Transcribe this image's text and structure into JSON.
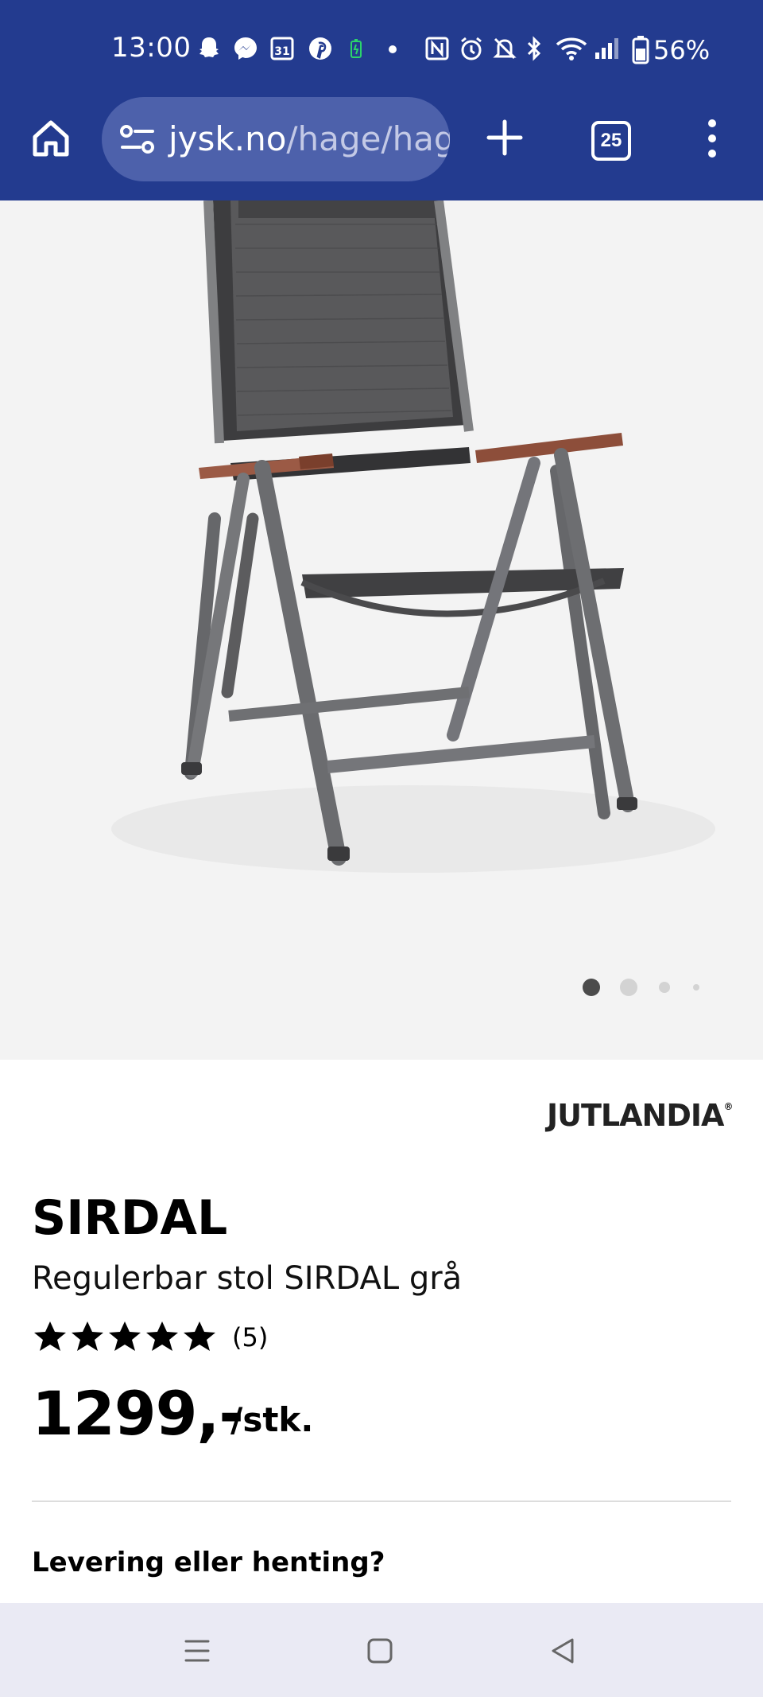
{
  "status_bar": {
    "time": "13:00",
    "battery_percent": "56%",
    "icons": [
      "snapchat-icon",
      "messenger-icon",
      "calendar-icon",
      "pinterest-icon",
      "battery-saver-icon",
      "dot-icon",
      "nfc-icon",
      "alarm-icon",
      "mute-icon",
      "bluetooth-icon",
      "wifi-icon",
      "signal-icon",
      "battery-icon"
    ],
    "calendar_day": "31"
  },
  "browser": {
    "url_domain": "jysk.no",
    "url_path": "/hage/hag",
    "tab_count": "25",
    "icons": [
      "home-icon",
      "site-settings-icon",
      "plus-icon",
      "tabs-icon",
      "more-icon"
    ]
  },
  "gallery": {
    "image_description_icon": "chair-image",
    "slide_count": 4,
    "active_slide": 1
  },
  "product": {
    "brand": "JUTLANDIA",
    "brand_mark": "®",
    "title": "SIRDAL",
    "subtitle": "Regulerbar stol SIRDAL grå",
    "rating_stars": 5,
    "review_count": "(5)",
    "price": "1299,-",
    "unit": "/stk."
  },
  "delivery": {
    "heading": "Levering eller henting?"
  },
  "nav_bar": {
    "icons": [
      "recents-icon",
      "home-button-icon",
      "back-icon"
    ]
  },
  "colors": {
    "header_bg": "#233b8f",
    "urlbar_bg": "#4d61ab",
    "gallery_bg": "#f3f3f3",
    "navbar_bg": "#eaeaf4"
  }
}
